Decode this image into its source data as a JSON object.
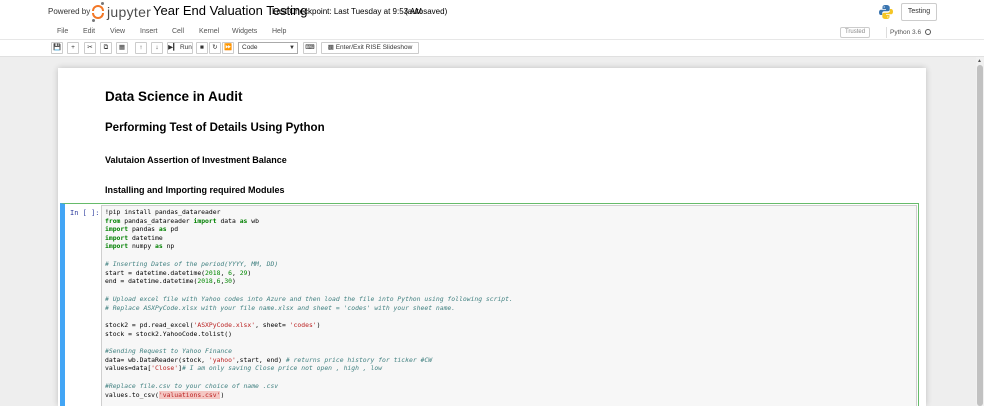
{
  "header": {
    "powered_by": "Powered by",
    "logo_text": "jupyter",
    "notebook_name": "Year End Valuation Testing",
    "checkpoint": "Last Checkpoint: Last Tuesday at 9:53 AM",
    "autosave": "(autosaved)",
    "kernel_button": "Testing"
  },
  "menubar": {
    "items": [
      "File",
      "Edit",
      "View",
      "Insert",
      "Cell",
      "Kernel",
      "Widgets",
      "Help"
    ],
    "trusted": "Trusted",
    "kernel_indicator": "Python 3.6"
  },
  "toolbar": {
    "run_label": "Run",
    "cell_type": "Code",
    "rise_label": "Enter/Exit RISE Slideshow"
  },
  "notebook": {
    "h1": "Data Science in Audit",
    "h2": "Performing Test of Details Using Python",
    "h3": "Valutaion Assertion of Investment Balance",
    "h3b": "Installing and Importing required Modules",
    "prompt": "In [ ]:",
    "code": {
      "l1": "!pip install pandas_datareader",
      "l2a": "from",
      "l2b": " pandas_datareader ",
      "l2c": "import",
      "l2d": " data ",
      "l2e": "as",
      "l2f": " wb",
      "l3a": "import",
      "l3b": " pandas ",
      "l3c": "as",
      "l3d": " pd",
      "l4a": "import",
      "l4b": " datetime",
      "l5a": "import",
      "l5b": " numpy ",
      "l5c": "as",
      "l5d": " np",
      "l6": "# Inserting Dates of the period(YYYY, MM, DD)",
      "l7a": "start = datetime.datetime(",
      "l7b": "2018",
      "l7c": ", ",
      "l7d": "6",
      "l7e": ", ",
      "l7f": "29",
      "l7g": ")",
      "l8a": "end = datetime.datetime(",
      "l8b": "2018",
      "l8c": ",",
      "l8d": "6",
      "l8e": ",",
      "l8f": "30",
      "l8g": ")",
      "l9": "# Upload excel file with Yahoo codes into Azure and then load the file into Python using following script.",
      "l10": "# Replace ASXPyCode.xlsx with your file name.xlsx and sheet = 'codes' with your sheet name.",
      "l11a": "stock2 = pd.read_excel(",
      "l11b": "'ASXPyCode.xlsx'",
      "l11c": ", sheet= ",
      "l11d": "'codes'",
      "l11e": ")",
      "l12": "stock = stock2.YahooCode.tolist()",
      "l13": "#Sending Request to Yahoo Finance",
      "l14a": "data= wb.DataReader(stock, ",
      "l14b": "'yahoo'",
      "l14c": ",start, end) ",
      "l14d": "# returns price history for ticker #CW",
      "l15a": "values=data[",
      "l15b": "'Close'",
      "l15c": "]",
      "l15d": "# I am only saving Close price not open , high , low",
      "l16": "#Replace file.csv to your choice of name .csv",
      "l17a": "values.to_csv(",
      "l17b": "'valuations.csv'",
      "l17c": ")"
    }
  }
}
